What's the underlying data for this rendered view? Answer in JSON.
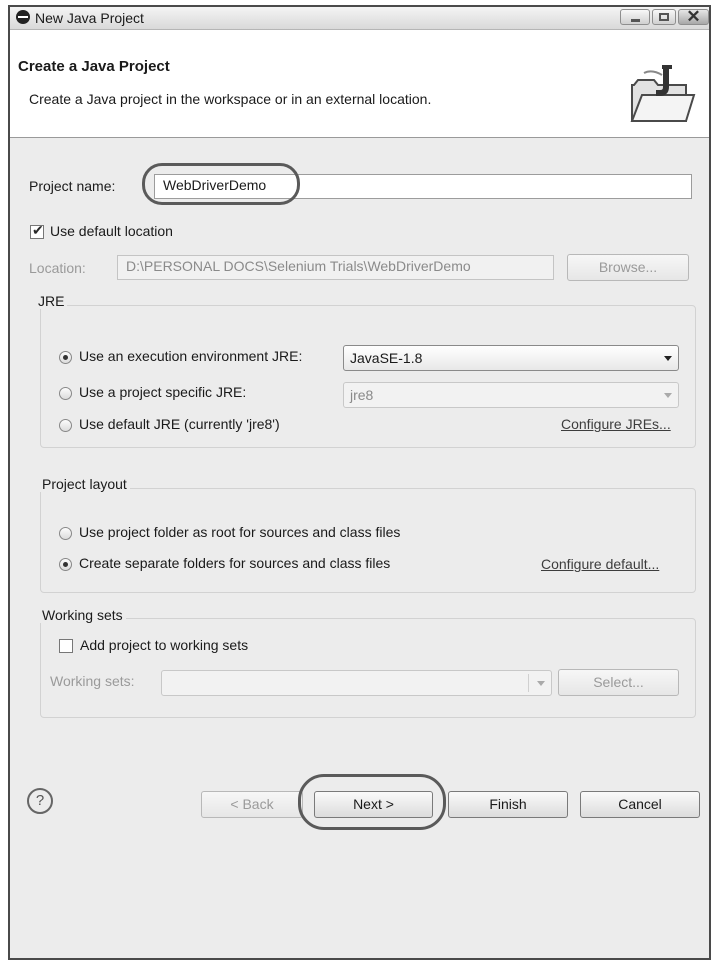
{
  "window": {
    "title": "New Java Project",
    "close_glyph": "✕"
  },
  "header": {
    "title": "Create a Java Project",
    "description": "Create a Java project in the workspace or in an external location."
  },
  "project": {
    "name_label": "Project name:",
    "name_value": "WebDriverDemo",
    "use_default_location_label": "Use default location",
    "use_default_location_checked": true,
    "location_label": "Location:",
    "location_value": "D:\\PERSONAL DOCS\\Selenium Trials\\WebDriverDemo",
    "browse_label": "Browse..."
  },
  "jre": {
    "group_title": "JRE",
    "execution_env_label": "Use an execution environment JRE:",
    "execution_env_value": "JavaSE-1.8",
    "project_specific_label": "Use a project specific JRE:",
    "project_specific_value": "jre8",
    "default_jre_label": "Use default JRE (currently 'jre8')",
    "configure_jres_link": "Configure JREs...",
    "selected": "execution_env"
  },
  "layout": {
    "group_title": "Project layout",
    "option_root_label": "Use project folder as root for sources and class files",
    "option_separate_label": "Create separate folders for sources and class files",
    "configure_default_link": "Configure default...",
    "selected": "separate"
  },
  "working_sets": {
    "group_title": "Working sets",
    "add_label": "Add project to working sets",
    "add_checked": false,
    "sets_label": "Working sets:",
    "sets_value": "",
    "select_label": "Select..."
  },
  "footer": {
    "help_glyph": "?",
    "back_label": "< Back",
    "next_label": "Next >",
    "finish_label": "Finish",
    "cancel_label": "Cancel"
  },
  "colors": {
    "dialog_background": "#ececec",
    "highlight_outline": "#5a5a5a"
  },
  "icons": [
    "app-icon",
    "folder-wizard-icon",
    "checkbox-tick-icon",
    "help-icon",
    "dropdown-arrow-icon"
  ]
}
